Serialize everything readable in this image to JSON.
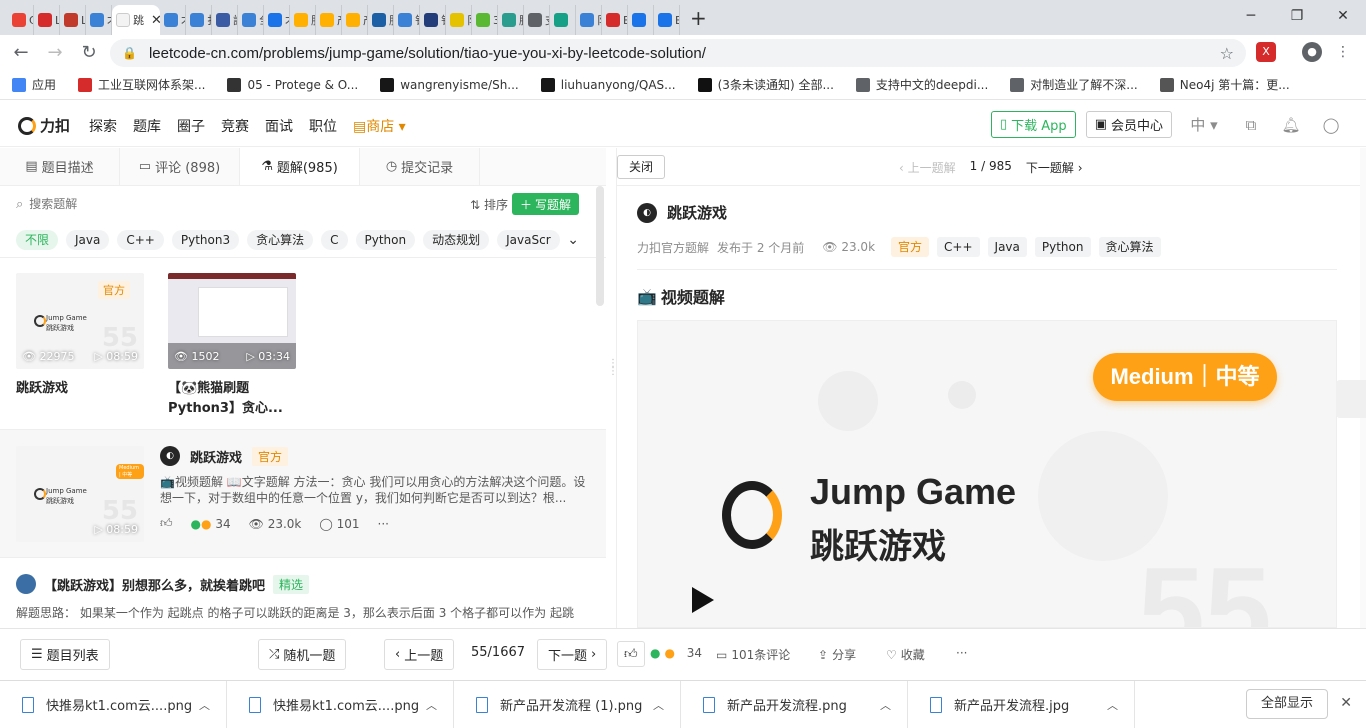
{
  "browser": {
    "active_tab_title": "跳",
    "tabs": [
      {
        "label": "C",
        "color": "#ea4335"
      },
      {
        "label": "L",
        "color": "#d62b2b"
      },
      {
        "label": "L",
        "color": "#c0392b"
      },
      {
        "label": "才",
        "color": "#3b82d6"
      },
      {
        "label": "才",
        "color": "#3b82d6"
      },
      {
        "label": "扌",
        "color": "#3b82d6"
      },
      {
        "label": "該",
        "color": "#3b5ba5"
      },
      {
        "label": "刍",
        "color": "#3b82d6"
      },
      {
        "label": "才",
        "color": "#1a73e8"
      },
      {
        "label": "肛",
        "color": "#ffb000"
      },
      {
        "label": "产",
        "color": "#ffb000"
      },
      {
        "label": "产",
        "color": "#ffb000"
      },
      {
        "label": "肛",
        "color": "#1d5fa5"
      },
      {
        "label": "钅",
        "color": "#3b82d6"
      },
      {
        "label": "钅",
        "color": "#223d7a"
      },
      {
        "label": "阝",
        "color": "#e4c200"
      },
      {
        "label": "3",
        "color": "#5bb832"
      },
      {
        "label": "肠",
        "color": "#2a9d8f"
      },
      {
        "label": "支",
        "color": "#5f6368"
      },
      {
        "label": "",
        "color": "#16a085"
      },
      {
        "label": "阝",
        "color": "#3b82d6"
      },
      {
        "label": "E",
        "color": "#d62b2b"
      },
      {
        "label": "刂",
        "color": "#1a73e8"
      },
      {
        "label": "E",
        "color": "#1a73e8"
      }
    ],
    "url": "leetcode-cn.com/problems/jump-game/solution/tiao-yue-you-xi-by-leetcode-solution/",
    "bookmarks": [
      {
        "label": "应用",
        "color": "#4285f4"
      },
      {
        "label": "工业互联网体系架...",
        "color": "#d62b2b"
      },
      {
        "label": "05 - Protege & O...",
        "color": "#333333"
      },
      {
        "label": "wangrenyisme/Sh...",
        "color": "#181717"
      },
      {
        "label": "liuhuanyong/QAS...",
        "color": "#181717"
      },
      {
        "label": "(3条未读通知) 全部...",
        "color": "#111111"
      },
      {
        "label": "支持中文的deepdi...",
        "color": "#5f6368"
      },
      {
        "label": "对制造业了解不深...",
        "color": "#5f6368"
      },
      {
        "label": "Neo4j 第十篇：更...",
        "color": "#555555"
      }
    ]
  },
  "site": {
    "logo_text": "力扣",
    "nav": [
      "探索",
      "题库",
      "圈子",
      "竞赛",
      "面试",
      "职位"
    ],
    "shop_label": "商店",
    "download_app": "下载 App",
    "vip_center": "会员中心",
    "lang": "中"
  },
  "left": {
    "tabs": [
      {
        "label": "题目描述"
      },
      {
        "label": "评论 (898)"
      },
      {
        "label": "题解(985)"
      },
      {
        "label": "提交记录"
      }
    ],
    "search_placeholder": "搜索题解",
    "sort_label": "排序",
    "write_label": "写题解",
    "tags": [
      "不限",
      "Java",
      "C++",
      "Python3",
      "贪心算法",
      "C",
      "Python",
      "动态规划",
      "JavaScr"
    ],
    "videos": [
      {
        "title": "跳跃游戏",
        "views": "22975",
        "duration": "08:59",
        "badge": "官方",
        "en": "Jump Game",
        "zh": "跳跃游戏",
        "num": "55"
      },
      {
        "title": "【🐼熊猫刷题Python3】贪心...",
        "views": "1502",
        "duration": "03:34"
      }
    ],
    "solution1": {
      "author": "跳跃游戏",
      "badge": "官方",
      "text": "📺视频题解 📖文字题解 方法一：贪心 我们可以用贪心的方法解决这个问题。设想一下，对于数组中的任意一个位置 y，我们如何判断它是否可以到达？根...",
      "likes": "34",
      "views": "23.0k",
      "comments": "101",
      "duration": "08:59",
      "thumb_en": "Jump Game",
      "thumb_zh": "跳跃游戏",
      "thumb_level": "Medium | 中等",
      "thumb_num": "55"
    },
    "solution2": {
      "title": "【跳跃游戏】别想那么多，就挨着跳吧",
      "badge": "精选",
      "text": "解题思路： 如果某一个作为 起跳点 的格子可以跳跃的距离是 3，那么表示后面 3 个格子都可以作为 起跳"
    }
  },
  "right": {
    "close_label": "关闭",
    "prev_label": "上一题解",
    "page": "1 / 985",
    "next_label": "下一题解",
    "title": "跳跃游戏",
    "author": "力扣官方题解",
    "published": "发布于 2 个月前",
    "views": "23.0k",
    "tags": [
      "官方",
      "C++",
      "Java",
      "Python",
      "贪心算法"
    ],
    "section_title": "视频题解",
    "video": {
      "level": "Medium｜中等",
      "title_en": "Jump Game",
      "title_zh": "跳跃游戏",
      "number": "55"
    }
  },
  "bottom": {
    "problem_list": "题目列表",
    "random": "随机一题",
    "prev": "上一题",
    "progress": "55/1667",
    "next": "下一题",
    "likes": "34",
    "comments": "101条评论",
    "share": "分享",
    "favorite": "收藏"
  },
  "downloads": {
    "items": [
      "快推易kt1.com云....png",
      "快推易kt1.com云....png",
      "新产品开发流程 (1).png",
      "新产品开发流程.png",
      "新产品开发流程.jpg"
    ],
    "show_all": "全部显示"
  }
}
